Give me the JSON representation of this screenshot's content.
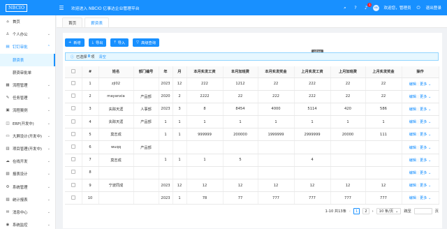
{
  "header": {
    "logo_text": "NBCIO",
    "welcome": "欢迎进入 NBCIO 亿事达企业管理平台",
    "user_greeting": "欢迎您，管理员",
    "logout": "退出登录",
    "notification_count": "1",
    "avatar_text": "NBC"
  },
  "sidebar": {
    "items": [
      {
        "label": "首页",
        "icon": "home-icon"
      },
      {
        "label": "个人办公",
        "icon": "user-icon"
      },
      {
        "label": "钉钉审批",
        "icon": "approval-icon"
      },
      {
        "label": "流程管理",
        "icon": "flow-icon"
      },
      {
        "label": "任务管理",
        "icon": "task-icon"
      },
      {
        "label": "流程案例",
        "icon": "case-icon"
      },
      {
        "label": "ERP(开发中)",
        "icon": "erp-icon"
      },
      {
        "label": "大屏设计(开发中)",
        "icon": "screen-icon"
      },
      {
        "label": "项目管理(开发中)",
        "icon": "project-icon"
      },
      {
        "label": "在线开发",
        "icon": "code-icon"
      },
      {
        "label": "报表设计",
        "icon": "report-icon"
      },
      {
        "label": "系统管理",
        "icon": "setting-icon"
      },
      {
        "label": "统计报表",
        "icon": "chart-icon"
      },
      {
        "label": "消息中心",
        "icon": "message-icon"
      },
      {
        "label": "系统监控",
        "icon": "monitor-icon"
      }
    ],
    "sub_items": [
      "薪资表",
      "薪资审批单"
    ]
  },
  "tabs": [
    {
      "label": "首页"
    },
    {
      "label": "薪资表"
    }
  ],
  "toolbar": {
    "add": "新增",
    "export": "导出",
    "import": "导入",
    "advanced_query": "高级查询",
    "tooltip": "gitee"
  },
  "alert": {
    "prefix": "已选择",
    "count": "0",
    "suffix": "项",
    "clear": "清空"
  },
  "table": {
    "columns": [
      "",
      "#",
      "姓名",
      "部门编号",
      "年",
      "月",
      "本月实发工资",
      "本月加班费",
      "本月实发奖金",
      "上月实发工资",
      "上月加班费",
      "上月实发奖金",
      "操作"
    ],
    "rows": [
      [
        "1",
        "zjl02",
        "",
        "2023",
        "12",
        "222",
        "1212",
        "22",
        "222",
        "22",
        "22"
      ],
      [
        "2",
        "mayanxia",
        "产品部",
        "2020",
        "2",
        "2222",
        "22",
        "222",
        "222",
        "22",
        "22"
      ],
      [
        "3",
        "失踪天涯",
        "人事部",
        "2023",
        "3",
        "8",
        "8454",
        "4000",
        "5114",
        "420",
        "586"
      ],
      [
        "4",
        "失踪天涯",
        "产品部",
        "1",
        "1",
        "1",
        "1",
        "1",
        "1",
        "1",
        "1"
      ],
      [
        "5",
        "莫志成",
        "",
        "1",
        "1",
        "999999",
        "200000",
        "1999999",
        "2999999",
        "20000",
        "111"
      ],
      [
        "6",
        "wuqq",
        "产品部",
        "",
        "",
        "",
        "",
        "",
        "",
        "",
        ""
      ],
      [
        "7",
        "莫志成",
        "",
        "1",
        "1",
        "1",
        "5",
        "",
        "4",
        "",
        ""
      ],
      [
        "8",
        "",
        "",
        "",
        "",
        "",
        "",
        "",
        "",
        "",
        ""
      ],
      [
        "9",
        "宁波同成",
        "",
        "2023",
        "12",
        "12",
        "12",
        "12",
        "12",
        "12",
        "12"
      ],
      [
        "10",
        "",
        "",
        "2023",
        "1",
        "78",
        "77",
        "777",
        "777",
        "777",
        "777"
      ]
    ],
    "edit": "编辑",
    "more": "更多"
  },
  "pagination": {
    "summary": "1-10 共13条",
    "pages": [
      "1",
      "2"
    ],
    "page_size": "10 条/页",
    "jump_label": "跳至",
    "jump_suffix": "页"
  }
}
